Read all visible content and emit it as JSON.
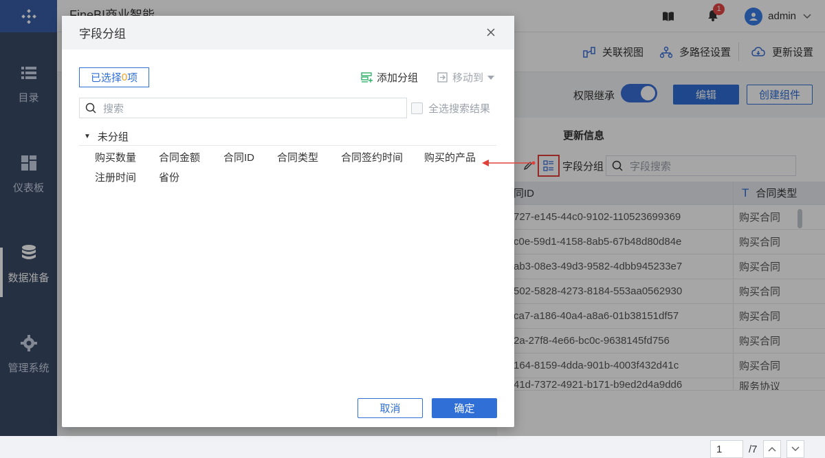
{
  "app": {
    "title": "FineBI商业智能"
  },
  "topbar": {
    "notification_count": "1",
    "user": "admin"
  },
  "sidebar": {
    "items": [
      {
        "label": "目录",
        "icon": "list-icon"
      },
      {
        "label": "仪表板",
        "icon": "dashboard-icon"
      },
      {
        "label": "数据准备",
        "icon": "database-icon",
        "active": true
      },
      {
        "label": "管理系统",
        "icon": "gear-icon"
      }
    ]
  },
  "toolbar": {
    "relation_view": "关联视图",
    "multi_path": "多路径设置",
    "update_settings": "更新设置"
  },
  "controls": {
    "permission_inherit": "权限继承",
    "permission_on": true,
    "edit": "编辑",
    "create_component": "创建组件"
  },
  "panel": {
    "update_info": "更新信息",
    "field_group": "字段分组",
    "field_search_placeholder": "字段搜索",
    "col_id_header": "同ID",
    "col_type_header": "合同类型",
    "rows": [
      {
        "id": "727-e145-44c0-9102-110523699369",
        "type": "购买合同"
      },
      {
        "id": "c0e-59d1-4158-8ab5-67b48d80d84e",
        "type": "购买合同"
      },
      {
        "id": "ab3-08e3-49d3-9582-4dbb945233e7",
        "type": "购买合同"
      },
      {
        "id": "502-5828-4273-8184-553aa0562930",
        "type": "购买合同"
      },
      {
        "id": "ca7-a186-40a4-a8a6-01b38151df57",
        "type": "购买合同"
      },
      {
        "id": "2a-27f8-4e66-bc0c-9638145fd756",
        "type": "购买合同"
      },
      {
        "id": "164-8159-4dda-901b-4003f432d41c",
        "type": "购买合同"
      },
      {
        "id": "41d-7372-4921-b171-b9ed2d4a9dd6",
        "type": "服务协议"
      }
    ],
    "page_current": "1",
    "page_total": "/7"
  },
  "dialog": {
    "title": "字段分组",
    "selected_prefix": "已选择",
    "selected_count": "0",
    "selected_suffix": "项",
    "add_group": "添加分组",
    "move_to": "移动到",
    "search_placeholder": "搜索",
    "select_all_results": "全选搜索结果",
    "ungrouped": "未分组",
    "fields_row1": [
      "购买数量",
      "合同金额",
      "合同ID",
      "合同类型",
      "合同签约时间",
      "购买的产品"
    ],
    "fields_row2": [
      "注册时间",
      "省份"
    ],
    "cancel": "取消",
    "confirm": "确定"
  },
  "colors": {
    "primary": "#2f6fd6",
    "sidebar": "#3a4a66",
    "highlight": "#e0403a"
  }
}
